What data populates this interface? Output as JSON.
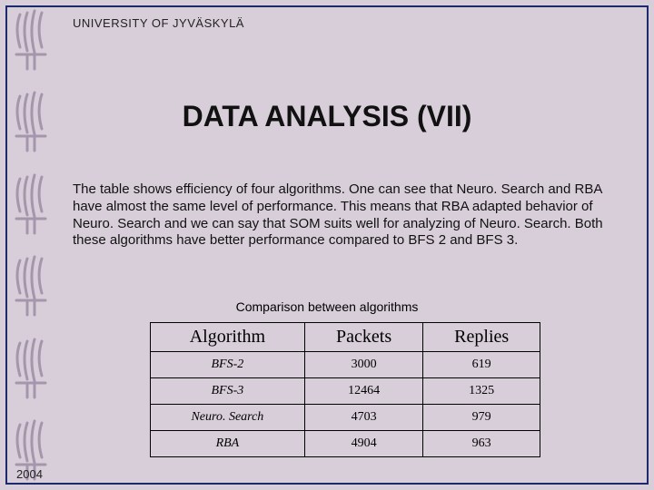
{
  "header": {
    "university": "UNIVERSITY OF JYVÄSKYLÄ"
  },
  "title": "DATA ANALYSIS (VII)",
  "body": "The table shows efficiency of four algorithms. One can see that Neuro. Search and RBA have almost the same level of performance. This means that RBA adapted behavior of Neuro. Search and we can say that SOM suits well for analyzing of Neuro. Search. Both these algorithms have better performance compared to BFS 2 and BFS 3.",
  "table": {
    "caption": "Comparison between algorithms",
    "headers": {
      "c0": "Algorithm",
      "c1": "Packets",
      "c2": "Replies"
    },
    "rows": [
      {
        "alg": "BFS-2",
        "packets": "3000",
        "replies": "619"
      },
      {
        "alg": "BFS-3",
        "packets": "12464",
        "replies": "1325"
      },
      {
        "alg": "Neuro. Search",
        "packets": "4703",
        "replies": "979"
      },
      {
        "alg": "RBA",
        "packets": "4904",
        "replies": "963"
      }
    ]
  },
  "footer": {
    "year": "2004"
  },
  "chart_data": {
    "type": "table",
    "title": "Comparison between algorithms",
    "columns": [
      "Algorithm",
      "Packets",
      "Replies"
    ],
    "rows": [
      [
        "BFS-2",
        3000,
        619
      ],
      [
        "BFS-3",
        12464,
        1325
      ],
      [
        "Neuro. Search",
        4703,
        979
      ],
      [
        "RBA",
        4904,
        963
      ]
    ]
  }
}
